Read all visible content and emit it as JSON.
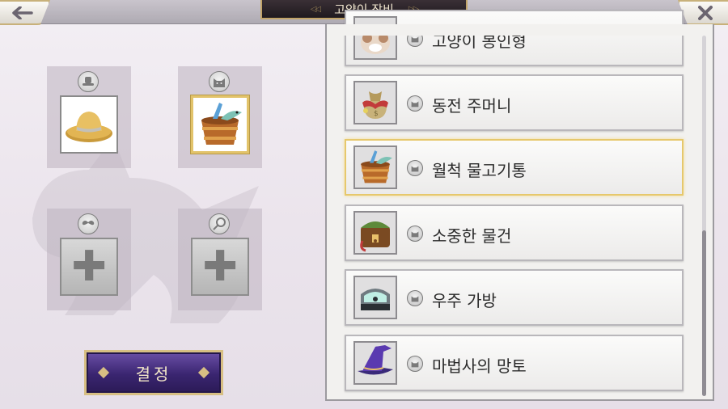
{
  "header": {
    "title": "고양이 장비",
    "back_icon": "back-arrow-icon",
    "close_icon": "close-x-icon"
  },
  "equipment_slots": [
    {
      "slot_type": "hat-slot-icon",
      "item_icon": "straw-hat-icon",
      "selected": false
    },
    {
      "slot_type": "cat-face-slot-icon",
      "item_icon": "fish-bucket-icon",
      "selected": true
    },
    {
      "slot_type": "mustache-slot-icon",
      "item_icon": "plus-icon",
      "selected": false
    },
    {
      "slot_type": "cat-tag-slot-icon",
      "item_icon": "plus-icon",
      "selected": false
    }
  ],
  "decide_button": {
    "label": "결정"
  },
  "item_list": [
    {
      "label": "고양이 봉인형",
      "icon": "cat-plush-icon",
      "selected": false
    },
    {
      "label": "동전 주머니",
      "icon": "coin-pouch-icon",
      "selected": false
    },
    {
      "label": "월척 물고기통",
      "icon": "fish-bucket-icon",
      "selected": true
    },
    {
      "label": "소중한 물건",
      "icon": "treasure-chest-icon",
      "selected": false
    },
    {
      "label": "우주 가방",
      "icon": "space-bag-icon",
      "selected": false
    },
    {
      "label": "마법사의 망토",
      "icon": "wizard-hat-icon",
      "selected": false
    }
  ],
  "colors": {
    "accent_gold": "#e2c36a",
    "button_purple": "#3a2570",
    "title_dark": "#1f1a1e"
  }
}
